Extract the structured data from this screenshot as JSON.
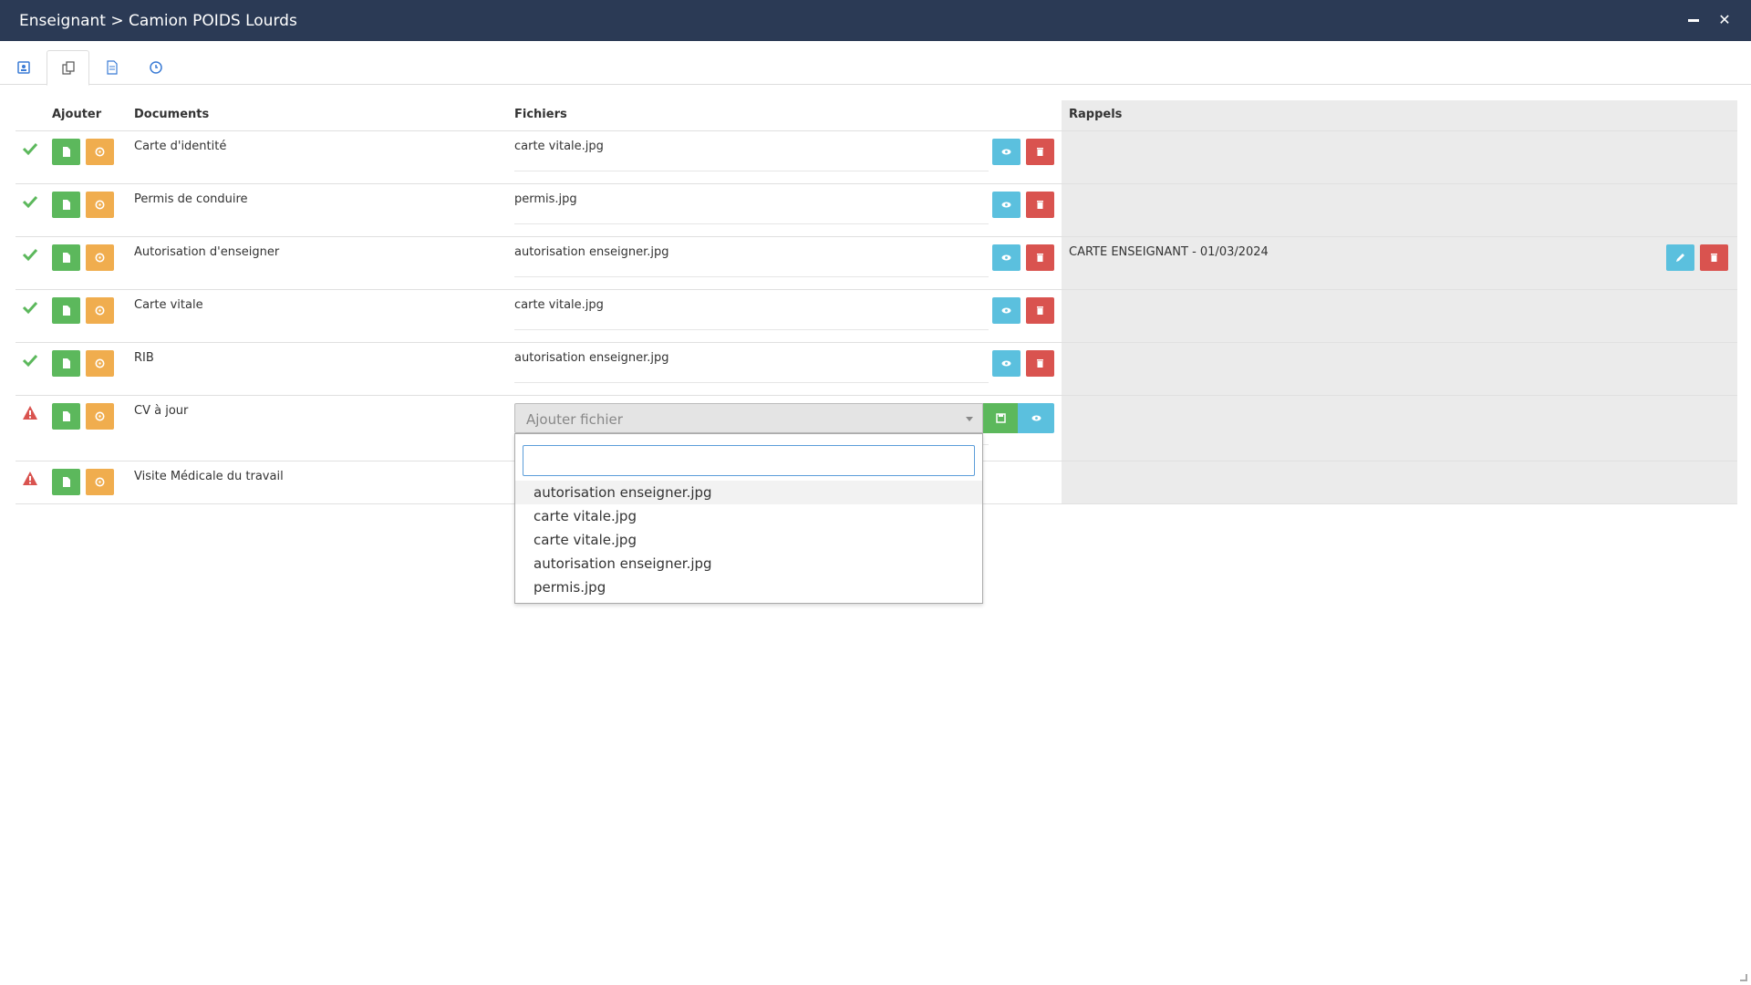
{
  "window": {
    "title": "Enseignant > Camion POIDS Lourds"
  },
  "tabs": [
    {
      "icon": "contact-card-icon"
    },
    {
      "icon": "documents-icon"
    },
    {
      "icon": "file-icon"
    },
    {
      "icon": "clock-icon"
    }
  ],
  "headers": {
    "ajouter": "Ajouter",
    "documents": "Documents",
    "fichiers": "Fichiers",
    "rappels": "Rappels"
  },
  "rows": [
    {
      "status": "ok",
      "document": "Carte d'identité",
      "file": "carte vitale.jpg",
      "reminder": ""
    },
    {
      "status": "ok",
      "document": "Permis de conduire",
      "file": "permis.jpg",
      "reminder": ""
    },
    {
      "status": "ok",
      "document": "Autorisation d'enseigner",
      "file": "autorisation enseigner.jpg",
      "reminder": "CARTE ENSEIGNANT - 01/03/2024"
    },
    {
      "status": "ok",
      "document": "Carte vitale",
      "file": "carte vitale.jpg",
      "reminder": ""
    },
    {
      "status": "ok",
      "document": "RIB",
      "file": "autorisation enseigner.jpg",
      "reminder": ""
    },
    {
      "status": "warning",
      "document": "CV à jour",
      "file": "",
      "reminder": ""
    },
    {
      "status": "warning",
      "document": "Visite Médicale du travail",
      "file": "",
      "reminder": ""
    }
  ],
  "file_select": {
    "placeholder": "Ajouter fichier",
    "search_value": "",
    "options": [
      "autorisation enseigner.jpg",
      "carte vitale.jpg",
      "carte vitale.jpg",
      "autorisation enseigner.jpg",
      "permis.jpg"
    ]
  },
  "colors": {
    "titlebar": "#2b3a55",
    "green": "#5cb85c",
    "orange": "#f0ad4e",
    "blue": "#5bc0de",
    "red": "#d9534f",
    "rappels_bg": "#ebebeb"
  }
}
